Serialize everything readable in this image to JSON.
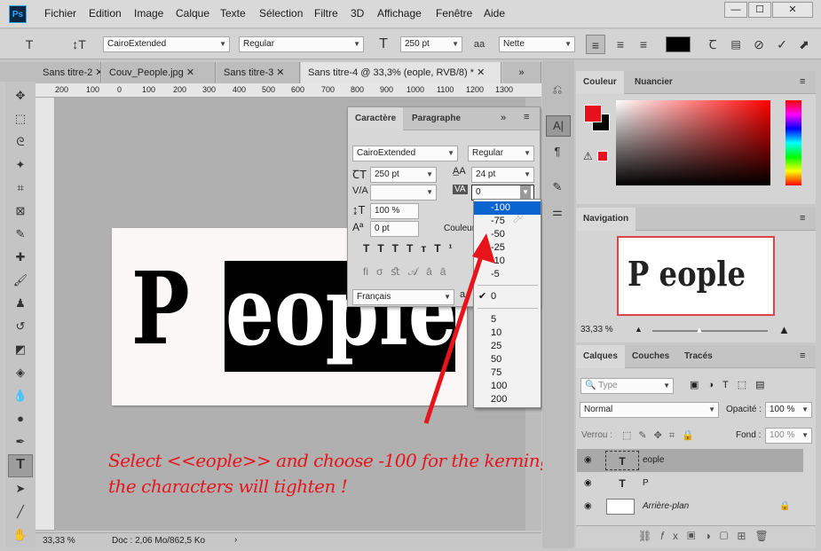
{
  "menubar": {
    "logo": "Ps",
    "items": [
      "Fichier",
      "Edition",
      "Image",
      "Calque",
      "Texte",
      "Sélection",
      "Filtre",
      "3D",
      "Affichage",
      "Fenêtre",
      "Aide"
    ],
    "win_min": "—",
    "win_max": "☐",
    "win_close": "✕"
  },
  "options": {
    "font": "CairoExtended",
    "style": "Regular",
    "size": "250 pt",
    "aa_label": "aa",
    "antialias": "Nette"
  },
  "tabs": [
    "Sans titre-2",
    "Couv_People.jpg",
    "Sans titre-3",
    "Sans titre-4 @ 33,3% (eople, RVB/8) *"
  ],
  "tab_more": "»",
  "ruler_ticks": [
    "200",
    "100",
    "0",
    "100",
    "200",
    "300",
    "400",
    "500",
    "600",
    "700",
    "800",
    "900",
    "1000",
    "1100",
    "1200",
    "1300"
  ],
  "canvas": {
    "p_letter": "P",
    "selected_text": "eople"
  },
  "character": {
    "tab1": "Caractère",
    "tab2": "Paragraphe",
    "font": "CairoExtended",
    "style": "Regular",
    "size": "250 pt",
    "leading": "24 pt",
    "kerning": "",
    "tracking": "0",
    "vscale": "100 %",
    "baseline": "0 pt",
    "color_label": "Couleur",
    "language": "Français",
    "more": "»"
  },
  "kerning_menu": {
    "items": [
      "-100",
      "-75",
      "-50",
      "-25",
      "-10",
      "-5",
      "0",
      "5",
      "10",
      "25",
      "50",
      "75",
      "100",
      "200"
    ],
    "selected": "-100",
    "checked": "0"
  },
  "annotation": {
    "line1": "Select <<eople>> and choose -100 for the kerning..",
    "line2": "the characters will tighten !",
    "color": "#e8141c"
  },
  "status": {
    "zoom": "33,33 %",
    "doc": "Doc : 2,06 Mo/862,5 Ko",
    "arrow": "›"
  },
  "color_panel": {
    "tab1": "Couleur",
    "tab2": "Nuancier",
    "fg": "#e8101c",
    "bg": "#000000"
  },
  "navigator": {
    "tab": "Navigation",
    "preview_text": "P eople",
    "zoom": "33,33 %"
  },
  "layers": {
    "tab1": "Calques",
    "tab2": "Couches",
    "tab3": "Tracés",
    "search": "Type",
    "blend": "Normal",
    "opacity_label": "Opacité :",
    "opacity": "100 %",
    "lock_label": "Verrou :",
    "fill_label": "Fond :",
    "fill": "100 %",
    "rows": [
      {
        "type": "T",
        "name": "eople"
      },
      {
        "type": "T",
        "name": "P"
      },
      {
        "type": "img",
        "name": "Arrière-plan"
      }
    ]
  }
}
